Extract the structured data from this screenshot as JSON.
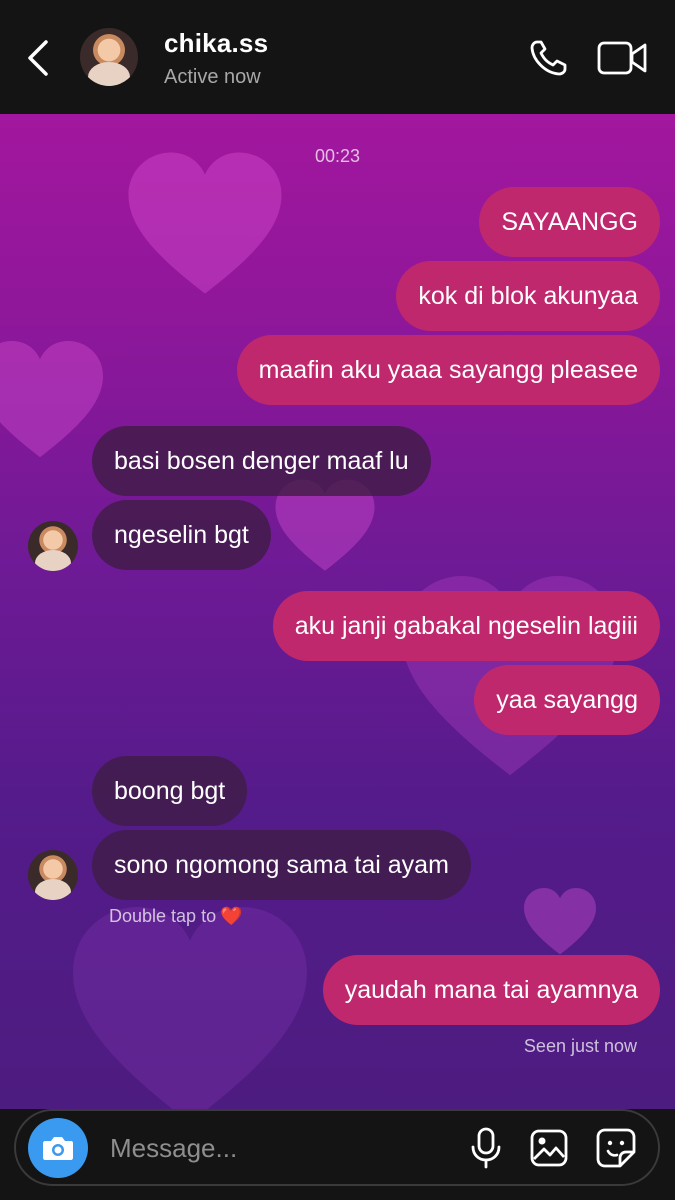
{
  "header": {
    "contact_name": "chika.ss",
    "status": "Active now",
    "icons": [
      "back-icon",
      "phone-icon",
      "video-icon"
    ]
  },
  "chat": {
    "timestamp": "00:23",
    "messages": [
      {
        "side": "outgoing",
        "text": "SAYAANGG"
      },
      {
        "side": "outgoing",
        "text": "kok di blok akunyaa"
      },
      {
        "side": "outgoing",
        "text": "maafin aku yaaa sayangg pleasee"
      },
      {
        "side": "incoming",
        "text": "basi bosen denger maaf lu"
      },
      {
        "side": "incoming",
        "text": "ngeselin bgt"
      },
      {
        "side": "outgoing",
        "text": "aku janji gabakal ngeselin lagiii"
      },
      {
        "side": "outgoing",
        "text": "yaa sayangg"
      },
      {
        "side": "incoming",
        "text": "boong bgt"
      },
      {
        "side": "incoming",
        "text": "sono ngomong sama tai ayam"
      },
      {
        "side": "outgoing",
        "text": "yaudah mana tai ayamnya"
      }
    ],
    "double_tap_hint": "Double tap to",
    "double_tap_emoji": "❤️",
    "seen_status": "Seen just now"
  },
  "composer": {
    "placeholder": "Message...",
    "icons": [
      "camera-icon",
      "microphone-icon",
      "gallery-icon",
      "sticker-icon"
    ]
  },
  "colors": {
    "outgoing_bubble": "#c0286e",
    "incoming_bubble": "#3e1c42",
    "camera_button": "#3a9af0",
    "background_top": "#a2179e",
    "background_bottom": "#4d1c80"
  }
}
